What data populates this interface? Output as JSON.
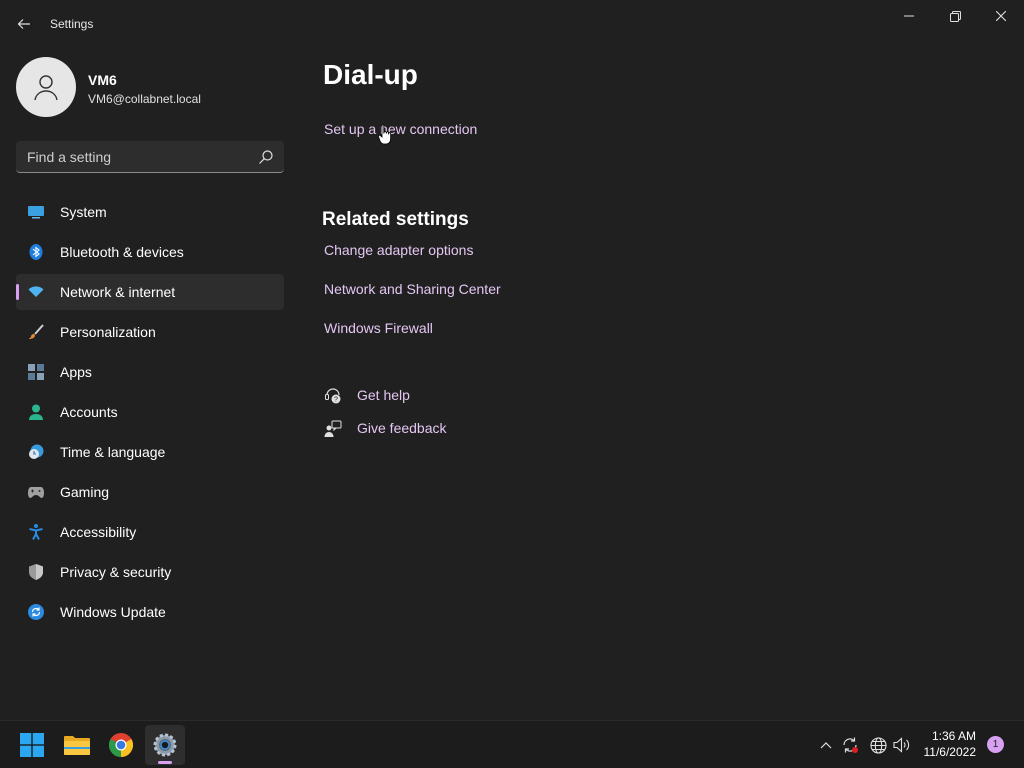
{
  "window": {
    "title": "Settings",
    "controls": [
      "minimize-icon",
      "maximize-icon",
      "close-icon"
    ]
  },
  "profile": {
    "name": "VM6",
    "email": "VM6@collabnet.local"
  },
  "search": {
    "placeholder": "Find a setting",
    "icon": "search-icon"
  },
  "nav": {
    "selected": "Network & internet",
    "items": [
      {
        "label": "System",
        "icon": "system-icon",
        "color": "#3aa0e0"
      },
      {
        "label": "Bluetooth & devices",
        "icon": "bluetooth-icon",
        "color": "#1e7ee0"
      },
      {
        "label": "Network & internet",
        "icon": "wifi-icon",
        "color": "#4fb3f0"
      },
      {
        "label": "Personalization",
        "icon": "brush-icon",
        "color": "#e08a3a"
      },
      {
        "label": "Apps",
        "icon": "apps-icon",
        "color": "#8aa0b8"
      },
      {
        "label": "Accounts",
        "icon": "person-icon",
        "color": "#2bb58f"
      },
      {
        "label": "Time & language",
        "icon": "clock-globe-icon",
        "color": "#3a9ae0"
      },
      {
        "label": "Gaming",
        "icon": "gamepad-icon",
        "color": "#a0a0a0"
      },
      {
        "label": "Accessibility",
        "icon": "accessibility-icon",
        "color": "#2a8ae0"
      },
      {
        "label": "Privacy & security",
        "icon": "shield-icon",
        "color": "#9a9a9a"
      },
      {
        "label": "Windows Update",
        "icon": "update-icon",
        "color": "#2a8ae0"
      }
    ]
  },
  "content": {
    "title": "Dial-up",
    "setup_link": "Set up a new connection",
    "related_title": "Related settings",
    "related_links": [
      "Change adapter options",
      "Network and Sharing Center",
      "Windows Firewall"
    ],
    "help": {
      "label": "Get help",
      "icon": "help-icon"
    },
    "feedback": {
      "label": "Give feedback",
      "icon": "feedback-icon"
    }
  },
  "taskbar": {
    "apps": [
      "start-icon",
      "file-explorer-icon",
      "chrome-icon",
      "settings-icon"
    ],
    "active_app": "settings-icon",
    "tray": [
      "chevron-up-icon",
      "sync-icon",
      "network-globe-icon",
      "volume-icon"
    ],
    "time": "1:36 AM",
    "date": "11/6/2022",
    "notification_count": "1"
  },
  "colors": {
    "accent": "#d8a0f0",
    "link": "#e4c6f2",
    "background": "#202020",
    "taskbar": "#1c1c1c"
  }
}
